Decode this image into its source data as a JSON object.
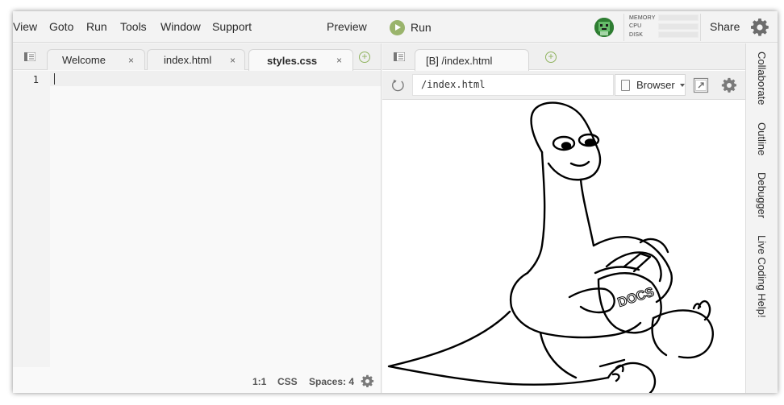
{
  "menubar": {
    "items": [
      "View",
      "Goto",
      "Run",
      "Tools",
      "Window",
      "Support"
    ],
    "preview": "Preview",
    "run": "Run",
    "meters": [
      "MEMORY",
      "CPU",
      "DISK"
    ],
    "share": "Share"
  },
  "editor": {
    "tabs": [
      {
        "label": "Welcome",
        "close": "×"
      },
      {
        "label": "index.html",
        "close": "×"
      },
      {
        "label": "styles.css",
        "close": "×"
      }
    ],
    "add_tab": "+",
    "line_number": "1",
    "status": {
      "position": "1:1",
      "mode": "CSS",
      "spaces": "Spaces: 4"
    }
  },
  "preview": {
    "tab_label": "[B] /index.html",
    "add_tab": "+",
    "url": "/index.html",
    "browser_label": "Browser",
    "drawing_text": "DOCS"
  },
  "sidebar": {
    "tabs": [
      "Collaborate",
      "Outline",
      "Debugger",
      "Live Coding Help!"
    ]
  },
  "colors": {
    "run_green": "#9ab46c",
    "add_green": "#8fb35e",
    "avatar_green": "#2e7d32"
  }
}
